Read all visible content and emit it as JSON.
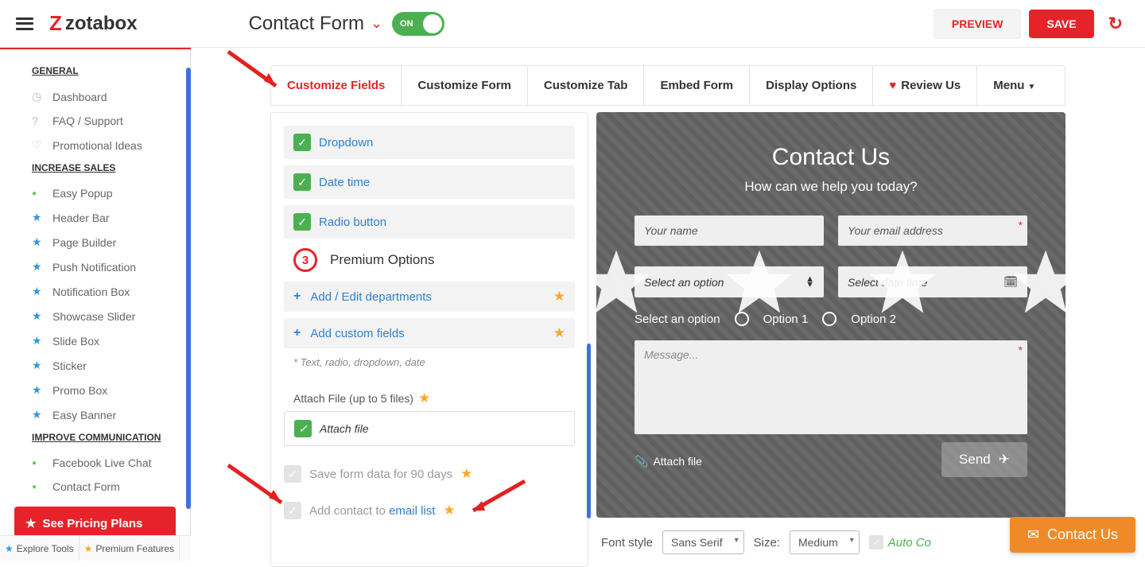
{
  "header": {
    "logo": "zotabox",
    "title": "Contact Form",
    "toggle": "ON",
    "preview": "PREVIEW",
    "save": "SAVE"
  },
  "sidebar": {
    "sections": {
      "general": {
        "label": "GENERAL",
        "items": [
          "Dashboard",
          "FAQ / Support",
          "Promotional Ideas"
        ]
      },
      "sales": {
        "label": "INCREASE SALES",
        "items": [
          "Easy Popup",
          "Header Bar",
          "Page Builder",
          "Push Notification",
          "Notification Box",
          "Showcase Slider",
          "Slide Box",
          "Sticker",
          "Promo Box",
          "Easy Banner"
        ]
      },
      "comm": {
        "label": "IMPROVE COMMUNICATION",
        "items": [
          "Facebook Live Chat",
          "Contact Form"
        ]
      }
    },
    "pricing_label": "See Pricing Plans",
    "explore": "Explore Tools",
    "premium": "Premium Features"
  },
  "tabs": {
    "t0": "Customize Fields",
    "t1": "Customize Form",
    "t2": "Customize Tab",
    "t3": "Embed Form",
    "t4": "Display Options",
    "t5": "Review Us",
    "t6": "Menu"
  },
  "panel": {
    "dropdown": "Dropdown",
    "datetime": "Date time",
    "radio": "Radio button",
    "badge": "3",
    "premium": "Premium Options",
    "add_dept": "Add / Edit departments",
    "add_custom": "Add custom fields",
    "note": "* Text, radio, dropdown, date",
    "attach_label": "Attach File (up to 5 files)",
    "attach": "Attach file",
    "save90": "Save form data for 90 days",
    "addcontact_pre": "Add contact to ",
    "addcontact_link": "email list"
  },
  "preview": {
    "title": "Contact Us",
    "sub": "How can we help you today?",
    "name_ph": "Your name",
    "email_ph": "Your email address",
    "select": "Select an option",
    "datetime": "Select date time",
    "radio_lab": "Select an option",
    "opt1": "Option 1",
    "opt2": "Option 2",
    "msg_ph": "Message...",
    "attach": "Attach file",
    "send": "Send"
  },
  "footer": {
    "fontstyle": "Font style",
    "font_value": "Sans Serif",
    "size": "Size:",
    "size_value": "Medium",
    "auto": "Auto Co"
  },
  "widget": "Contact Us"
}
